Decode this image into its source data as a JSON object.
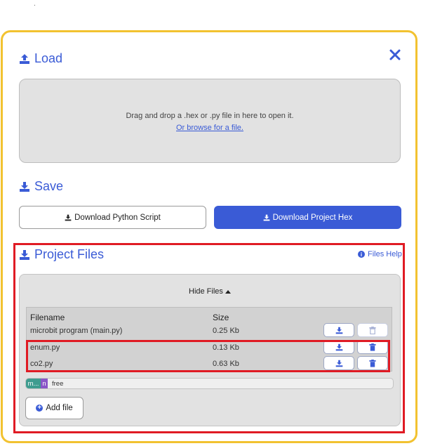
{
  "stray_mark": ".",
  "load": {
    "title": "Load",
    "close_icon": "close-icon"
  },
  "dropzone": {
    "line1": "Drag and drop a .hex or .py file in here to open it.",
    "browse": "Or browse for a file."
  },
  "save": {
    "title": "Save",
    "download_python": "Download Python Script",
    "download_hex": "Download Project Hex"
  },
  "project_files": {
    "title": "Project Files",
    "help": "Files Help",
    "toggle": "Hide Files",
    "headers": {
      "filename": "Filename",
      "size": "Size"
    },
    "files": [
      {
        "name": "microbit program (main.py)",
        "size": "0.25 Kb"
      },
      {
        "name": "enum.py",
        "size": "0.13 Kb"
      },
      {
        "name": "co2.py",
        "size": "0.63 Kb"
      }
    ],
    "storage": {
      "seg1": "m...",
      "seg2": "n",
      "free": "free"
    },
    "add_file": "Add file"
  },
  "colors": {
    "accent": "#3a5bd6",
    "modal_border": "#f2c230",
    "highlight": "#e01b24"
  }
}
